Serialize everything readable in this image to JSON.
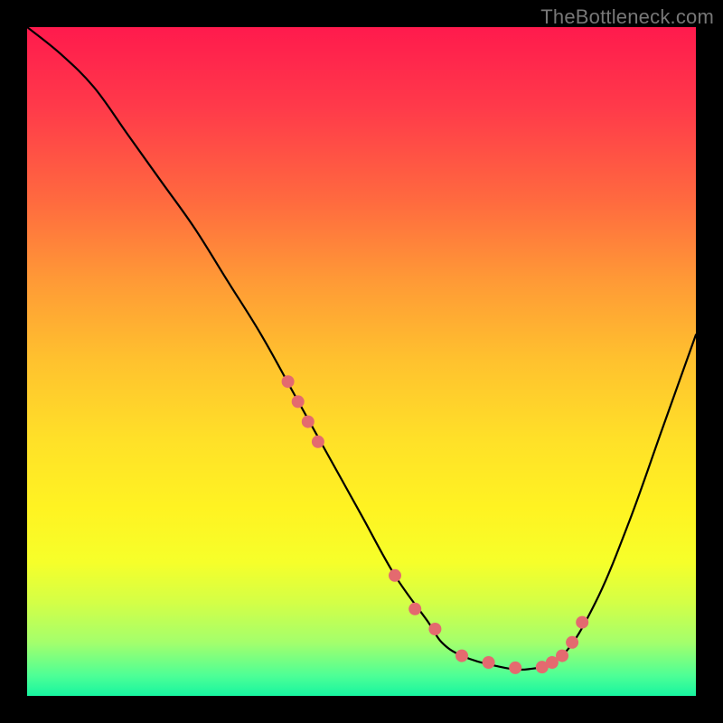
{
  "watermark": "TheBottleneck.com",
  "chart_data": {
    "type": "line",
    "title": "",
    "xlabel": "",
    "ylabel": "",
    "xlim": [
      0,
      100
    ],
    "ylim": [
      0,
      100
    ],
    "series": [
      {
        "name": "curve",
        "x": [
          0,
          5,
          10,
          15,
          20,
          25,
          30,
          35,
          40,
          45,
          50,
          55,
          60,
          62,
          65,
          70,
          75,
          80,
          85,
          90,
          95,
          100
        ],
        "values": [
          100,
          96,
          91,
          84,
          77,
          70,
          62,
          54,
          45,
          36,
          27,
          18,
          11,
          8,
          6,
          4.5,
          4,
          6,
          14,
          26,
          40,
          54
        ]
      }
    ],
    "markers": {
      "name": "highlight-points",
      "x": [
        39,
        40.5,
        42,
        43.5,
        55,
        58,
        61,
        65,
        69,
        73,
        77,
        78.5,
        80,
        81.5,
        83
      ],
      "values": [
        47,
        44,
        41,
        38,
        18,
        13,
        10,
        6,
        5,
        4.2,
        4.3,
        5,
        6,
        8,
        11
      ],
      "color": "#e46a6f",
      "radius": 7
    },
    "colors": {
      "curve": "#000000",
      "background_top": "#ff1a4d",
      "background_bottom": "#17f5a0"
    }
  }
}
